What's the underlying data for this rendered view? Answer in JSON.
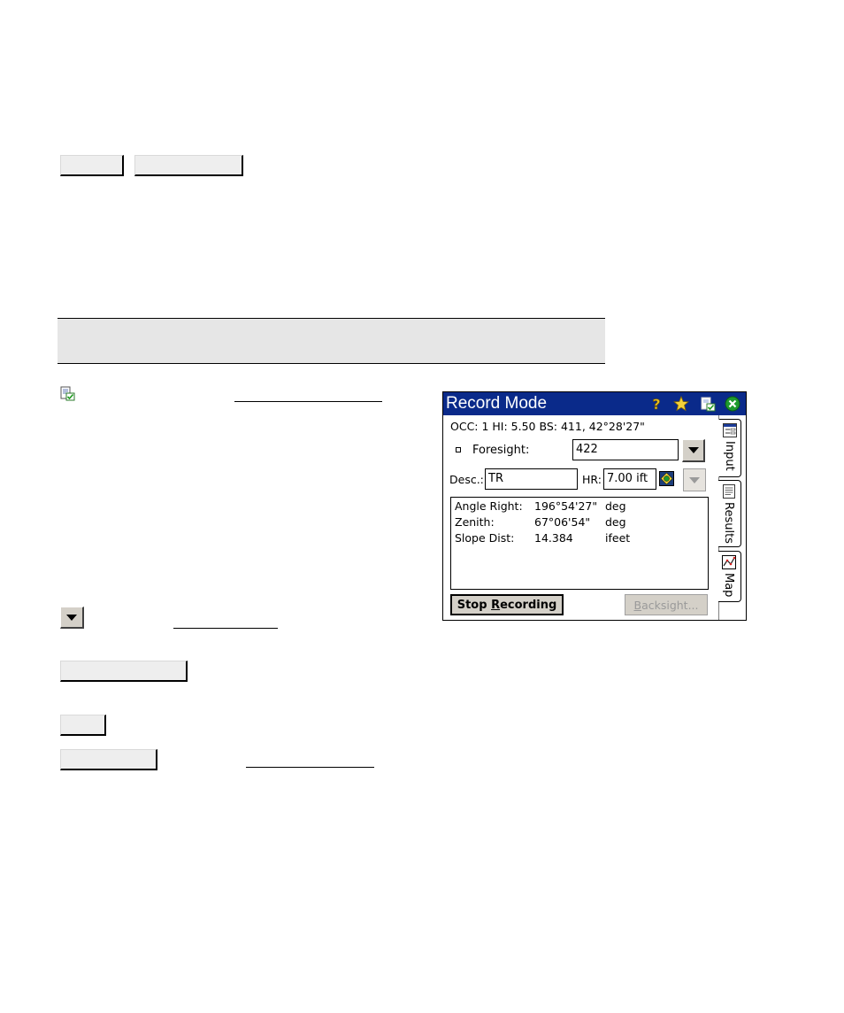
{
  "record_mode": {
    "title": "Record Mode",
    "title_icons": [
      "help-icon",
      "favorites-star-icon",
      "clipboard-check-icon",
      "close-icon"
    ],
    "occ_line": "OCC: 1  HI: 5.50  BS: 411, 42°28'27\"",
    "foresight_label": "Foresight:",
    "foresight_value": "422",
    "desc_label": "Desc.:",
    "desc_value": "TR",
    "hr_label": "HR:",
    "hr_value": "7.00 ift",
    "results": [
      {
        "label": "Angle Right:",
        "value": "196°54'27\"",
        "unit": "deg"
      },
      {
        "label": "Zenith:",
        "value": "67°06'54\"",
        "unit": "deg"
      },
      {
        "label": "Slope Dist:",
        "value": "14.384",
        "unit": "ifeet"
      }
    ],
    "stop_button": {
      "pre": "Stop ",
      "hot": "R",
      "post": "ecording"
    },
    "backsight_button": {
      "hot": "B",
      "post": "acksight..."
    },
    "tabs": [
      {
        "label": "Input",
        "icon": "input-form-icon",
        "active": true
      },
      {
        "label": "Results",
        "icon": "results-sheet-icon",
        "active": false
      },
      {
        "label": "Map",
        "icon": "map-icon",
        "active": false
      }
    ]
  },
  "colors": {
    "titlebar": "#0a2a8a",
    "button_face": "#d4d0c8",
    "shade_band": "#e6e6e6"
  }
}
